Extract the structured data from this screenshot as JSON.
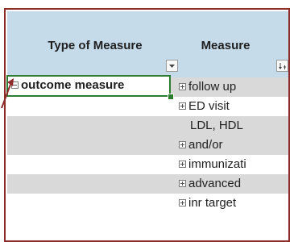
{
  "header": {
    "type_of_measure": "Type of Measure",
    "measure": "Measure"
  },
  "selected_cell": {
    "label": "outcome measure"
  },
  "measure_items": [
    "follow up",
    "ED visit",
    "LDL, HDL",
    "and/or",
    "immunizati",
    "advanced",
    "inr target"
  ],
  "colors": {
    "frame_border": "#8e2b2b",
    "header_bg": "#c5dbea",
    "row_shade": "#d9d9d9",
    "selection": "#2e7d32"
  }
}
